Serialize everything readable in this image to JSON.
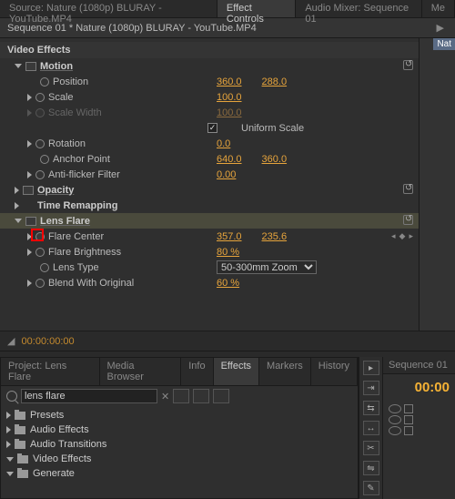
{
  "top_tabs": {
    "source": "Source: Nature (1080p) BLURAY - YouTube.MP4",
    "effect_controls": "Effect Controls",
    "audio_mixer": "Audio Mixer: Sequence 01",
    "extra": "Me"
  },
  "sequence_name": "Sequence 01 * Nature (1080p) BLURAY - YouTube.MP4",
  "right_tab": "Nat",
  "video_effects_title": "Video Effects",
  "motion": {
    "title": "Motion",
    "position": {
      "label": "Position",
      "x": "360.0",
      "y": "288.0"
    },
    "scale": {
      "label": "Scale",
      "value": "100.0"
    },
    "scale_width": {
      "label": "Scale Width",
      "value": "100.0"
    },
    "uniform": {
      "label": "Uniform Scale",
      "checked": "✓"
    },
    "rotation": {
      "label": "Rotation",
      "value": "0.0"
    },
    "anchor": {
      "label": "Anchor Point",
      "x": "640.0",
      "y": "360.0"
    },
    "antiflicker": {
      "label": "Anti-flicker Filter",
      "value": "0.00"
    }
  },
  "opacity": {
    "title": "Opacity"
  },
  "time_remap": {
    "title": "Time Remapping"
  },
  "lens_flare": {
    "title": "Lens Flare",
    "center": {
      "label": "Flare Center",
      "x": "357.0",
      "y": "235.6"
    },
    "brightness": {
      "label": "Flare Brightness",
      "value": "80 %"
    },
    "lens_type": {
      "label": "Lens Type",
      "value": "50-300mm Zoom"
    },
    "blend": {
      "label": "Blend With Original",
      "value": "60 %"
    }
  },
  "timecode_small": "00:00:00:00",
  "project_tabs": {
    "project": "Project: Lens Flare",
    "media_browser": "Media Browser",
    "info": "Info",
    "effects": "Effects",
    "markers": "Markers",
    "history": "History"
  },
  "search_value": "lens flare",
  "tree": {
    "presets": "Presets",
    "audio_effects": "Audio Effects",
    "audio_transitions": "Audio Transitions",
    "video_effects": "Video Effects",
    "generate": "Generate"
  },
  "timeline": {
    "header": "Sequence 01",
    "timecode": "00:00"
  }
}
